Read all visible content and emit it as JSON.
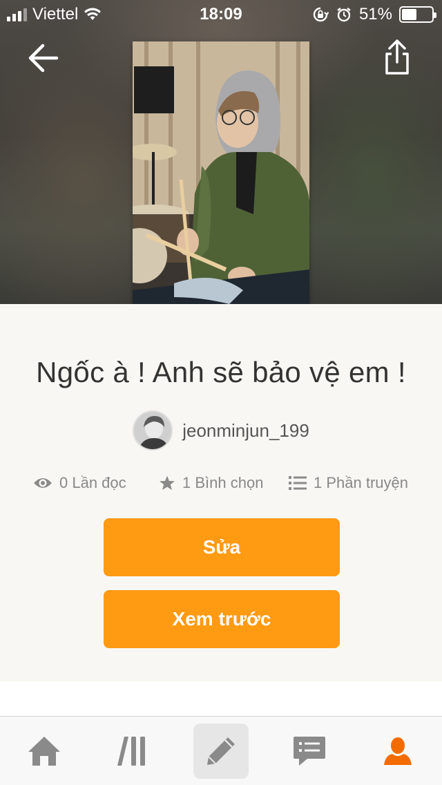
{
  "status_bar": {
    "carrier": "Viettel",
    "time": "18:09",
    "battery_percent_label": "51%",
    "battery_level": 0.51
  },
  "header": {
    "back_icon": "arrow-left-icon",
    "share_icon": "share-icon"
  },
  "story": {
    "title": "Ngốc à ! Anh sẽ bảo vệ em !",
    "author": "jeonminjun_199",
    "stats": {
      "reads": "0 Lần đọc",
      "votes": "1 Bình chọn",
      "parts": "1 Phần truyện"
    }
  },
  "actions": {
    "edit_label": "Sửa",
    "preview_label": "Xem trước"
  },
  "tabbar": {
    "items": [
      {
        "icon": "home-icon",
        "active": false
      },
      {
        "icon": "library-icon",
        "active": false
      },
      {
        "icon": "pencil-icon",
        "active": true
      },
      {
        "icon": "chat-icon",
        "active": false
      },
      {
        "icon": "profile-icon",
        "active": false
      }
    ]
  },
  "colors": {
    "accent": "#ff9a13",
    "profile_tab": "#f36c00",
    "icon_gray": "#8a8a8a"
  }
}
